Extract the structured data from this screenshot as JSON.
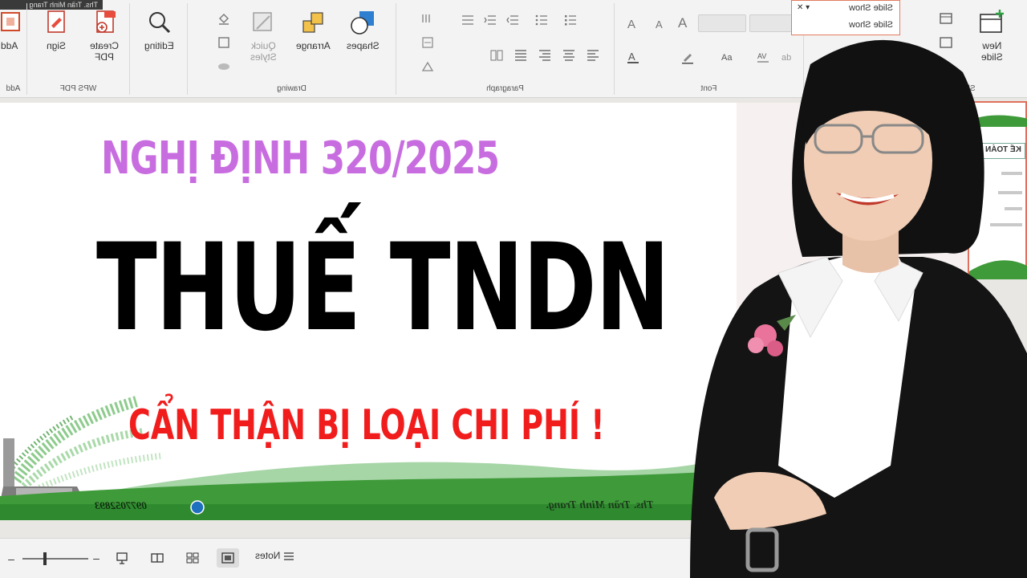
{
  "window": {
    "titlebar_text": "Ths. Trần Minh Trang"
  },
  "ribbon": {
    "groups": [
      {
        "label": "Add",
        "key": "add"
      },
      {
        "label": "WPS PDF",
        "key": "wps_pdf"
      },
      {
        "label": "Drawing",
        "key": "drawing"
      },
      {
        "label": "Paragraph",
        "key": "paragraph"
      },
      {
        "label": "Font",
        "key": "font"
      },
      {
        "label": "Sli",
        "key": "slides"
      }
    ],
    "buttons": {
      "add": "Add",
      "sign": "Sign",
      "create_pdf": "Create\nPDF",
      "editing": "Editing",
      "quick_styles": "Quick\nStyles",
      "arrange": "Arrange",
      "shapes": "Shapes",
      "new_slide": "New\nSlide"
    },
    "slide_show_menu": {
      "item1": "Slide Show",
      "item2": "Slide Show"
    }
  },
  "slide": {
    "line1": "NGHỊ ĐỊNH 320/2025",
    "line2": "THUẾ TNDN",
    "line3": "CẨN THẬN BỊ LOẠI CHI PHÍ !",
    "footer_phone": "0977052893",
    "footer_author": "Ths. Trần Minh Trang."
  },
  "thumbnail": {
    "heading": "KẾ TOÁN"
  },
  "statusbar": {
    "notes_label": "Notes"
  },
  "colors": {
    "title_purple": "#c86de0",
    "warning_red": "#f11d1d",
    "ribbon_bg": "#f3f3f3",
    "slide_green": "#3f9a3a"
  }
}
